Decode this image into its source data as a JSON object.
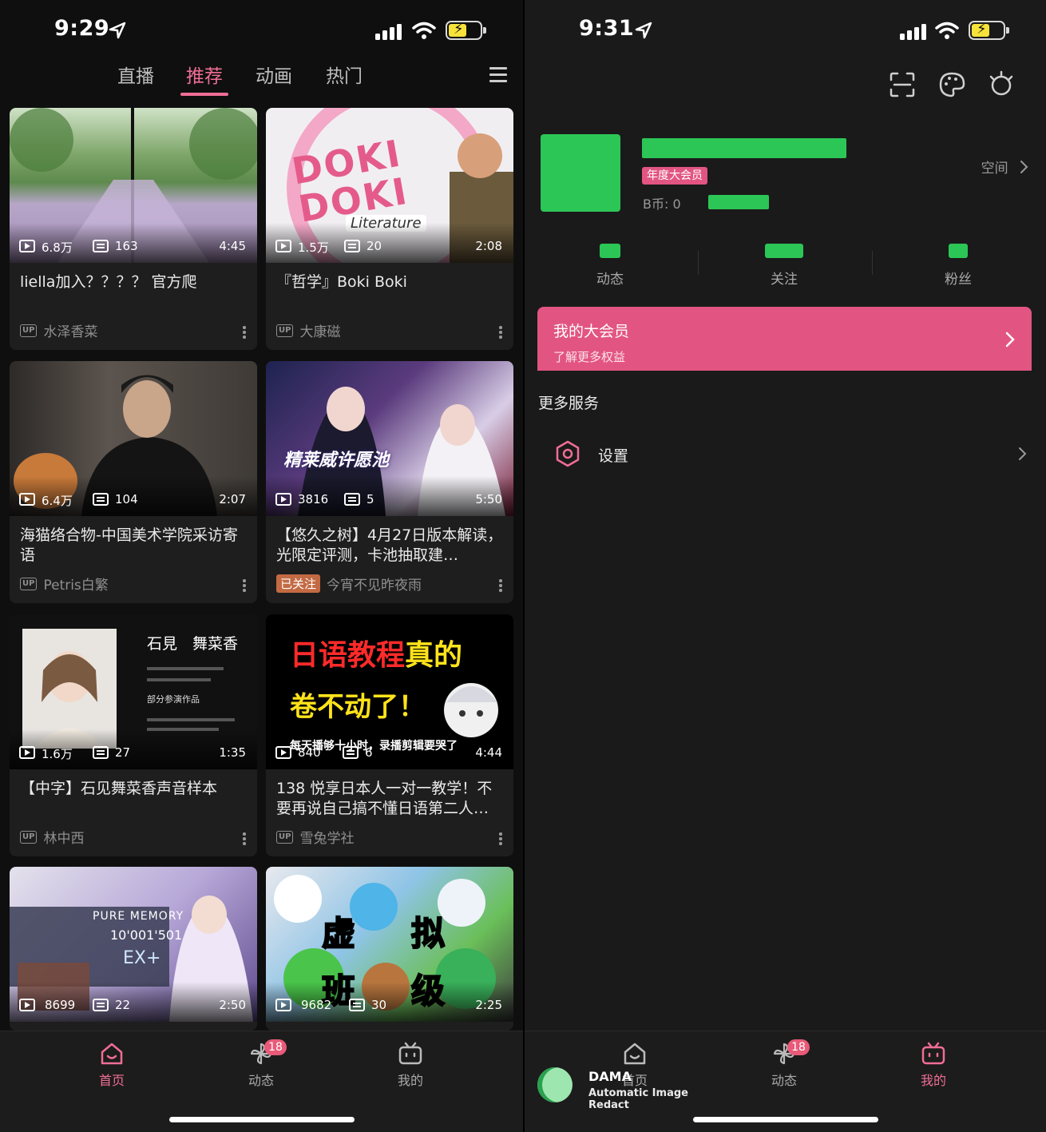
{
  "left": {
    "status": {
      "time": "9:29"
    },
    "tabs": [
      "直播",
      "推荐",
      "动画",
      "热门"
    ],
    "active_tab": "推荐",
    "cards": [
      {
        "views": "6.8万",
        "danmaku": "163",
        "duration": "4:45",
        "title": "liella加入？？？？ 官方爬",
        "up": "水泽香菜",
        "badge": "UP"
      },
      {
        "views": "1.5万",
        "danmaku": "20",
        "duration": "2:08",
        "title": "『哲学』Boki Boki",
        "up": "大康磁",
        "badge": "UP"
      },
      {
        "views": "6.4万",
        "danmaku": "104",
        "duration": "2:07",
        "title": "海猫络合物-中国美术学院采访寄语",
        "up": "Petris白繁",
        "badge": "UP"
      },
      {
        "views": "3816",
        "danmaku": "5",
        "duration": "5:50",
        "title": "【悠久之树】4月27日版本解读，光限定评测，卡池抽取建…",
        "up": "今宵不见昨夜雨",
        "badge": "已关注"
      },
      {
        "views": "1.6万",
        "danmaku": "27",
        "duration": "1:35",
        "title": "【中字】石见舞菜香声音样本",
        "up": "林中西",
        "badge": "UP"
      },
      {
        "views": "840",
        "danmaku": "6",
        "duration": "4:44",
        "title": "138 悦享日本人一对一教学！不要再说自己搞不懂日语第二人…",
        "up": "雪兔学社",
        "badge": "UP"
      },
      {
        "views": "8699",
        "danmaku": "22",
        "duration": "2:50"
      },
      {
        "views": "9682",
        "danmaku": "30",
        "duration": "2:25"
      }
    ],
    "thumb_text": {
      "doki_logo": "DOKI DOKI",
      "doki_sub": "Literature",
      "anime_title": "精莱威许愿池",
      "profile_name": "石見　舞菜香",
      "profile_sub": "部分参演作品",
      "jp_line1a": "日语教程",
      "jp_line1b": "真的",
      "jp_line2": "卷不动了！",
      "jp_caption": "每天播够十小时，录播剪辑要哭了",
      "game_title": "PURE MEMORY",
      "game_score": "10'001'501",
      "game_grade": "EX+",
      "vt_chars": [
        "虚",
        "拟",
        "班",
        "级"
      ]
    },
    "nav": {
      "home": "首页",
      "dynamic": "动态",
      "mine": "我的",
      "badge": "18"
    }
  },
  "right": {
    "status": {
      "time": "9:31"
    },
    "vip_tag": "年度大会员",
    "coin_label": "B币: 0",
    "space_link": "空间",
    "stats": [
      "动态",
      "关注",
      "粉丝"
    ],
    "vip_card": {
      "title": "我的大会员",
      "subtitle": "了解更多权益"
    },
    "section_title": "更多服务",
    "settings_label": "设置",
    "nav": {
      "home": "首页",
      "dynamic": "动态",
      "mine": "我的",
      "badge": "18"
    },
    "watermark": {
      "title": "DAMA",
      "subtitle": "Automatic Image Redact"
    }
  },
  "colors": {
    "accent": "#f06e96",
    "vip": "#e25582",
    "redaction": "#2cc656"
  }
}
